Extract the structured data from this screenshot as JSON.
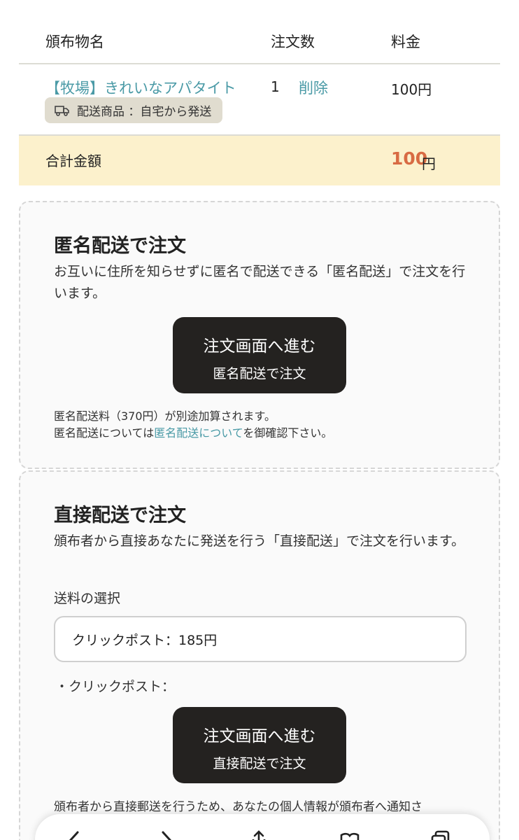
{
  "table": {
    "headers": {
      "name": "頒布物名",
      "quantity": "注文数",
      "price": "料金"
    },
    "item": {
      "name": "【牧場】きれいなアパタイト",
      "shipping_badge": "配送商品 ：自宅から発送",
      "quantity": "1",
      "delete_label": "削除",
      "price": "100円"
    },
    "total": {
      "label": "合計金額",
      "amount": "100",
      "unit": "円"
    }
  },
  "anonymous": {
    "title": "匿名配送で注文",
    "description": "お互いに住所を知らせずに匿名で配送できる「匿名配送」で注文を行います。",
    "button_main": "注文画面へ進む",
    "button_sub": "匿名配送で注文",
    "note_line1": "匿名配送料（370円）が別途加算されます。",
    "note_line2_prefix": "匿名配送については",
    "note_line2_link": "匿名配送について",
    "note_line2_suffix": "を御確認下さい。"
  },
  "direct": {
    "title": "直接配送で注文",
    "description": "頒布者から直接あなたに発送を行う「直接配送」で注文を行います。",
    "shipping_label": "送料の選択",
    "shipping_selected": "クリックポスト：185円",
    "bullet": "・クリックポスト：",
    "button_main": "注文画面へ進む",
    "button_sub": "直接配送で注文",
    "note": "頒布者から直接郵送を行うため、あなたの個人情報が頒布者へ通知さ"
  },
  "bottom_bar": {
    "icons": [
      "back-icon",
      "forward-icon",
      "share-icon",
      "bookmarks-icon",
      "tabs-icon"
    ]
  },
  "colors": {
    "link": "#4a9aa6",
    "total_amount": "#d86b43",
    "total_bg": "#fcf1cc",
    "badge_bg": "#e0dccf",
    "button_bg": "#242220"
  }
}
